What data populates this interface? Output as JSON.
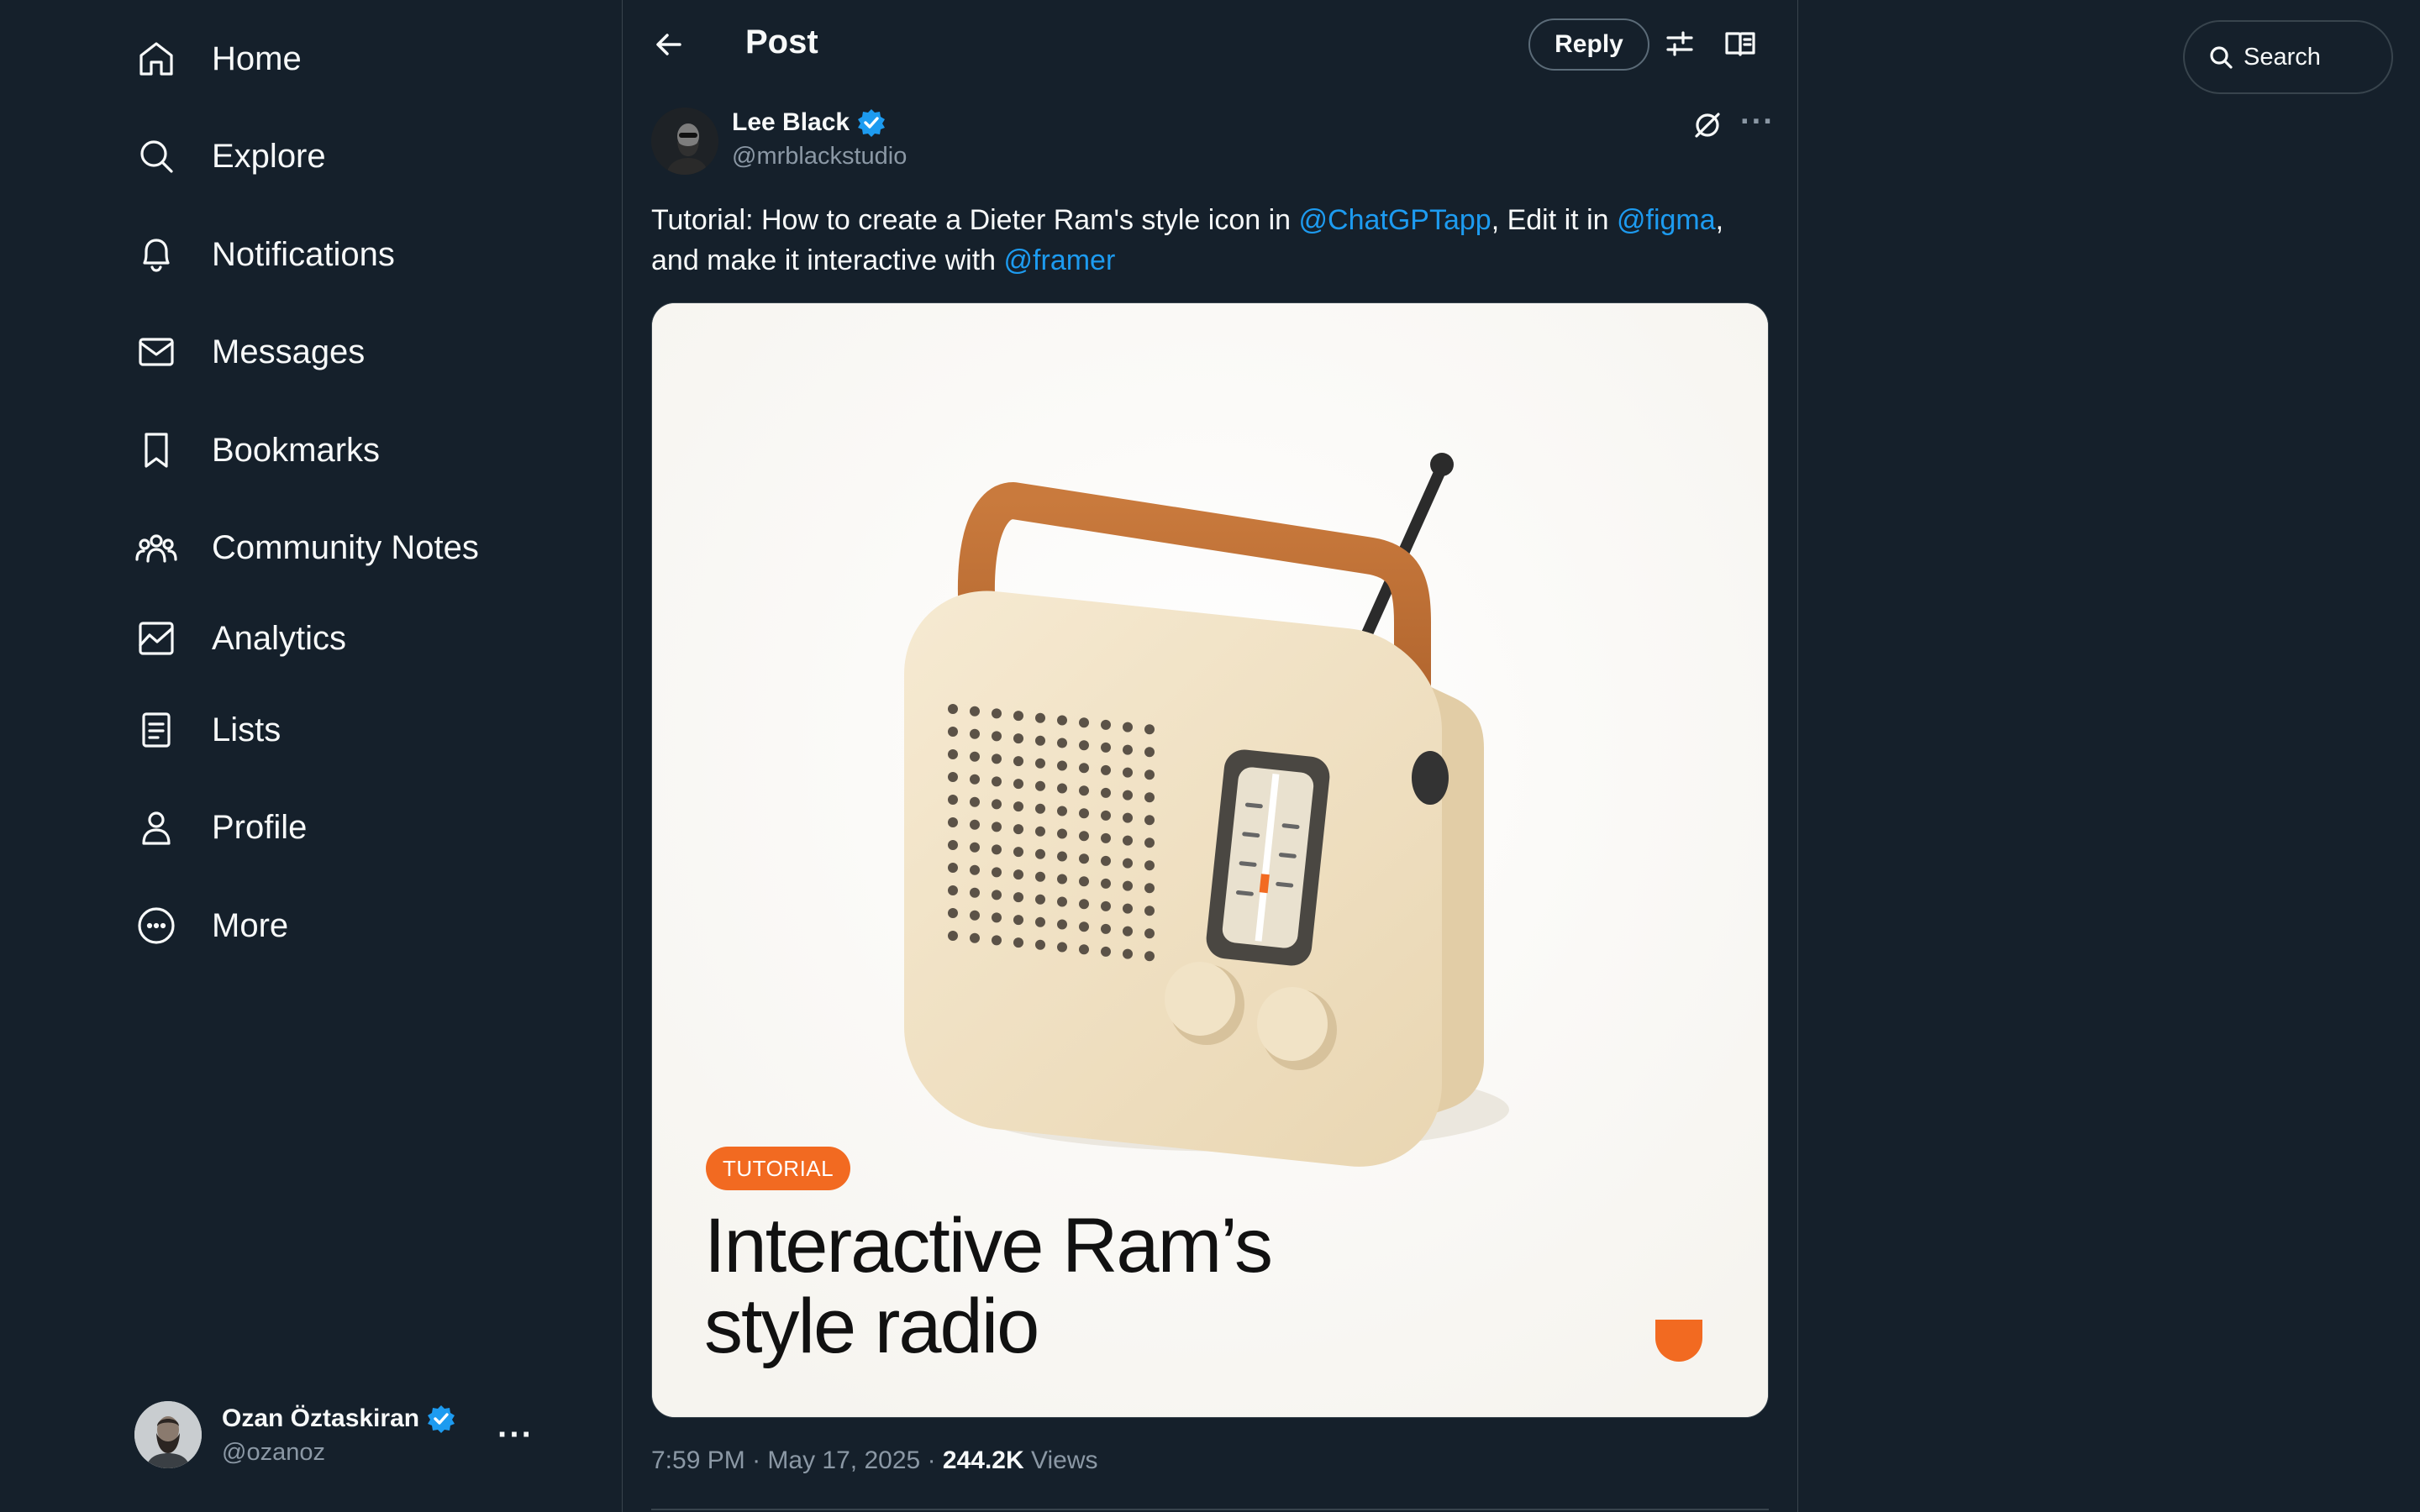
{
  "nav": {
    "items": [
      {
        "label": "Home",
        "icon": "home-icon"
      },
      {
        "label": "Explore",
        "icon": "search-icon"
      },
      {
        "label": "Notifications",
        "icon": "bell-icon"
      },
      {
        "label": "Messages",
        "icon": "envelope-icon"
      },
      {
        "label": "Bookmarks",
        "icon": "bookmark-icon"
      },
      {
        "label": "Community Notes",
        "icon": "people-icon"
      },
      {
        "label": "Analytics",
        "icon": "chart-icon"
      },
      {
        "label": "Lists",
        "icon": "list-icon"
      },
      {
        "label": "Profile",
        "icon": "person-icon"
      },
      {
        "label": "More",
        "icon": "more-circle-icon"
      }
    ]
  },
  "account": {
    "name": "Ozan Öztaskiran",
    "handle": "@ozanoz",
    "more": "···"
  },
  "header": {
    "title": "Post",
    "reply_label": "Reply"
  },
  "post": {
    "author_name": "Lee Black",
    "author_handle": "@mrblackstudio",
    "more": "···",
    "text": {
      "part1": "Tutorial: How to create a Dieter Ram's style icon in ",
      "mention1": "@ChatGPTapp",
      "part2": ", Edit it in ",
      "mention2": "@figma",
      "part3": ", and make it interactive with ",
      "mention3": "@framer"
    },
    "image": {
      "badge": "TUTORIAL",
      "headline_line1": "Interactive Ram’s",
      "headline_line2": "style radio"
    },
    "time": "7:59 PM",
    "date": "May 17, 2025",
    "views_count": "244.2K",
    "views_label": "Views",
    "separator": "·"
  },
  "search": {
    "placeholder": "Search"
  },
  "colors": {
    "background": "#15202b",
    "accent": "#1d9bf0",
    "secondary_text": "#8b98a5",
    "border": "#38444d",
    "badge_orange": "#f26a21"
  }
}
